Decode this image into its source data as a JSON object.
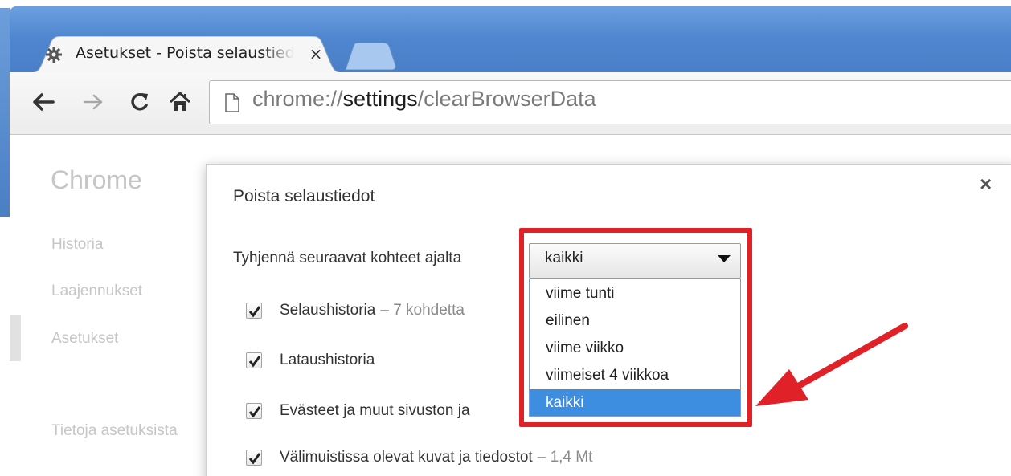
{
  "browser": {
    "tab_title": "Asetukset - Poista selaustiedot",
    "tab_close": "×",
    "url_scheme": "chrome://",
    "url_host": "settings",
    "url_path": "/clearBrowserData"
  },
  "settings": {
    "heading": "Chrome",
    "sidebar": [
      {
        "label": "Historia"
      },
      {
        "label": "Laajennukset"
      },
      {
        "label": "Asetukset"
      },
      {
        "label": "Tietoja asetuksista"
      }
    ]
  },
  "dialog": {
    "title": "Poista selaustiedot",
    "close": "×",
    "clear_label": "Tyhjennä seuraavat kohteet ajalta",
    "select_value": "kaikki",
    "menu_options": [
      "viime tunti",
      "eilinen",
      "viime viikko",
      "viimeiset 4 viikkoa",
      "kaikki"
    ],
    "selected_option": "kaikki",
    "checkboxes": [
      {
        "label": "Selaushistoria",
        "extra": "– 7 kohdetta",
        "checked": true
      },
      {
        "label": "Lataushistoria",
        "extra": "",
        "checked": true
      },
      {
        "label": "Evästeet ja muut sivuston ja",
        "extra": "",
        "checked": true
      },
      {
        "label": "Välimuistissa olevat kuvat ja tiedostot",
        "extra": "– 1,4 Mt",
        "checked": true
      }
    ]
  },
  "colors": {
    "highlight": "#e02127",
    "menu_selected": "#3d8ee0",
    "tabstrip": "#4f86cf"
  },
  "icons": {
    "favicon": "gear-icon",
    "back": "back-arrow-icon",
    "forward": "forward-arrow-icon",
    "reload": "reload-icon",
    "home": "home-icon",
    "page": "page-icon"
  }
}
